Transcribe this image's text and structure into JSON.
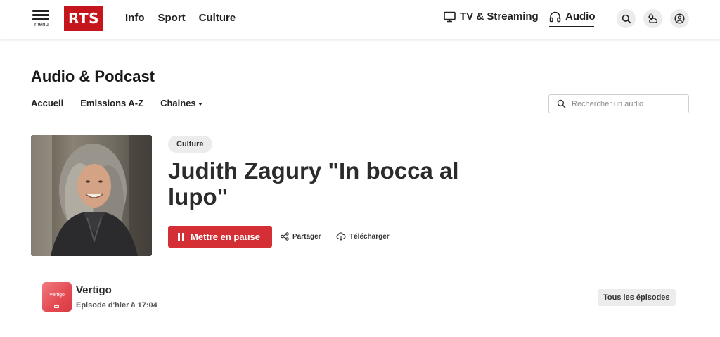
{
  "header": {
    "menu_label": "menu",
    "logo_text": "RTS",
    "nav": [
      {
        "label": "Info"
      },
      {
        "label": "Sport"
      },
      {
        "label": "Culture"
      }
    ],
    "tv_label": "TV & Streaming",
    "audio_label": "Audio",
    "icons": [
      "search-icon",
      "weather-icon",
      "account-icon"
    ]
  },
  "page": {
    "title": "Audio & Podcast",
    "subnav": [
      {
        "label": "Accueil"
      },
      {
        "label": "Emissions A-Z"
      },
      {
        "label": "Chaines"
      }
    ],
    "search_placeholder": "Rechercher un audio"
  },
  "episode": {
    "category": "Culture",
    "title": "Judith Zagury \"In bocca al lupo\"",
    "pause_label": "Mettre en pause",
    "share_label": "Partager",
    "download_label": "Télécharger"
  },
  "show": {
    "name": "Vertigo",
    "logo_text": "Vertigo",
    "subtitle": "Episode d'hier à 17:04",
    "all_episodes_label": "Tous les épisodes"
  },
  "colors": {
    "brand_red": "#c4161c",
    "button_red": "#d32f34",
    "chip_gray": "#ececec"
  }
}
